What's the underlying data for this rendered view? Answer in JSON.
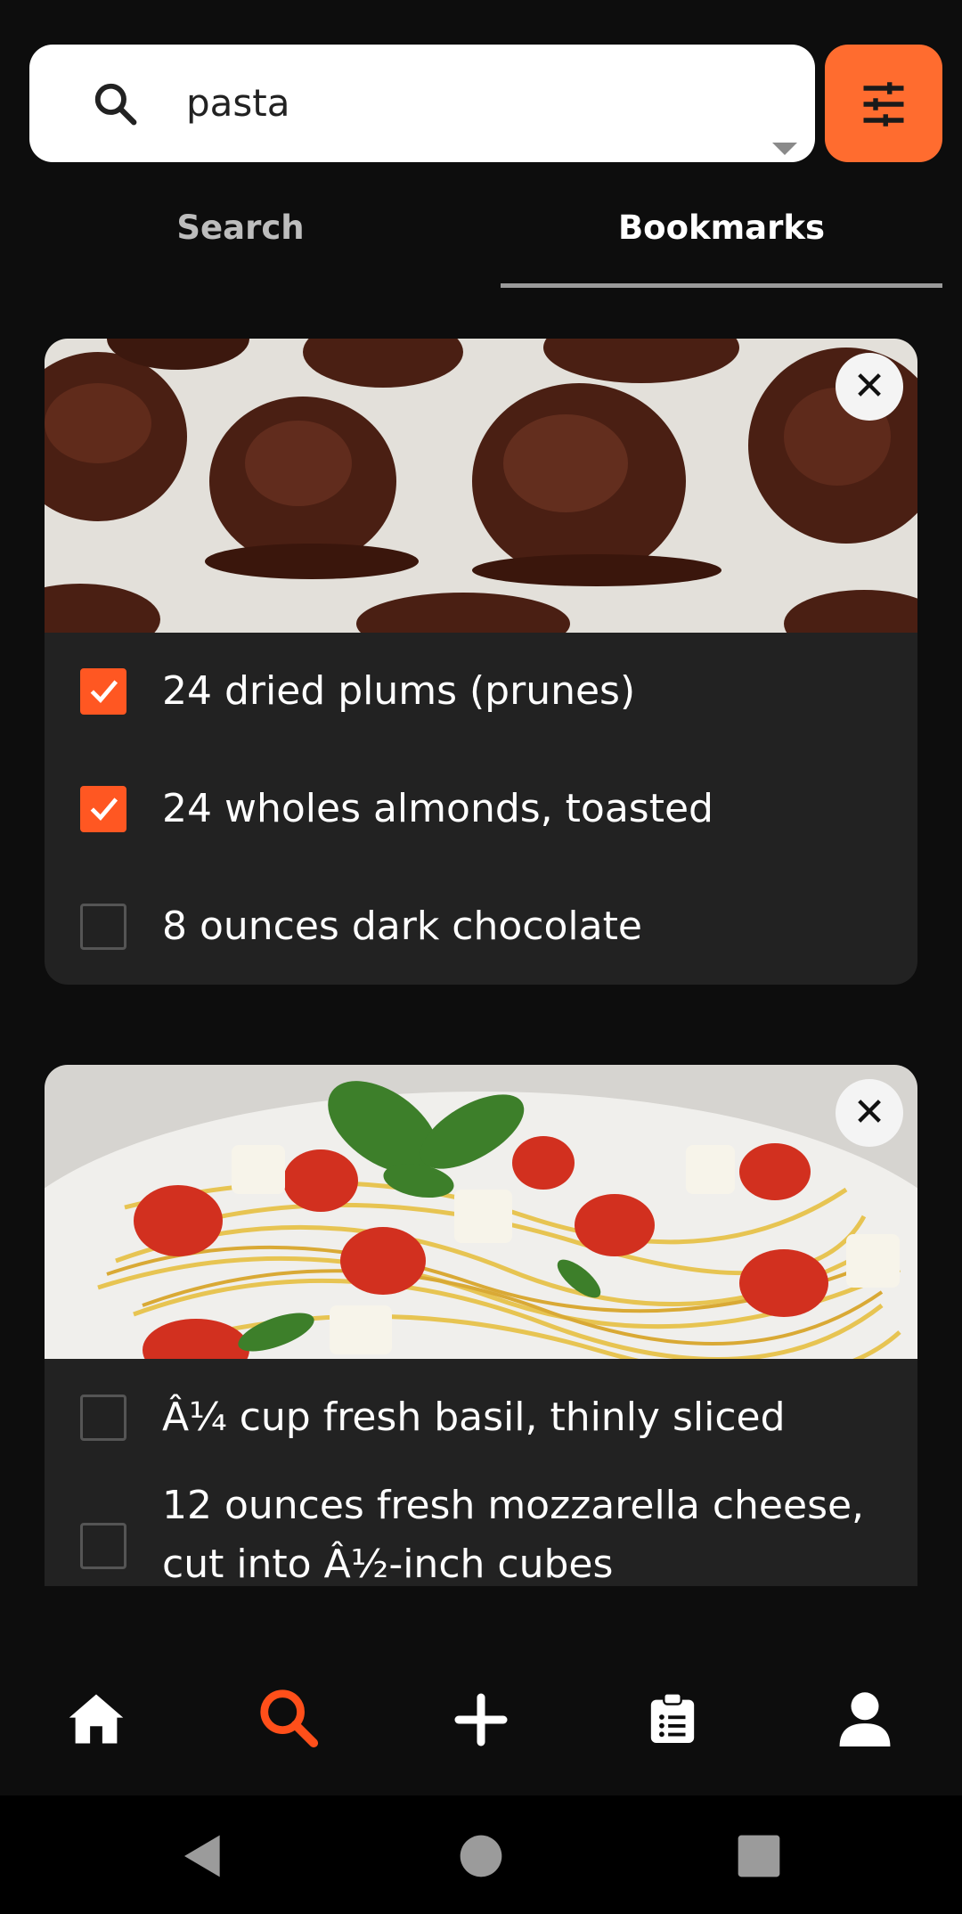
{
  "search": {
    "query": "pasta"
  },
  "tabs": [
    {
      "label": "Search",
      "active": false
    },
    {
      "label": "Bookmarks",
      "active": true
    }
  ],
  "cards": [
    {
      "image": "chocolate-covered-prunes-photo",
      "ingredients": [
        {
          "text": "24 dried plums (prunes)",
          "checked": true
        },
        {
          "text": "24 wholes almonds, toasted",
          "checked": true
        },
        {
          "text": "8 ounces dark chocolate",
          "checked": false
        }
      ]
    },
    {
      "image": "pasta-caprese-photo",
      "ingredients": [
        {
          "text": "Â¼ cup fresh basil, thinly sliced",
          "checked": false
        },
        {
          "text": "12 ounces fresh mozzarella cheese, cut into Â½-inch cubes",
          "checked": false
        }
      ]
    }
  ],
  "bottom_nav": [
    {
      "icon": "home-icon",
      "active": false
    },
    {
      "icon": "search-icon",
      "active": true
    },
    {
      "icon": "add-icon",
      "active": false
    },
    {
      "icon": "clipboard-list-icon",
      "active": false
    },
    {
      "icon": "user-icon",
      "active": false
    }
  ],
  "system_nav": [
    "back-icon",
    "home-circle-icon",
    "recents-icon"
  ],
  "colors": {
    "accent": "#ff6c2f",
    "checkbox": "#ff5722",
    "card": "#222222",
    "background": "#0d0d0d"
  }
}
